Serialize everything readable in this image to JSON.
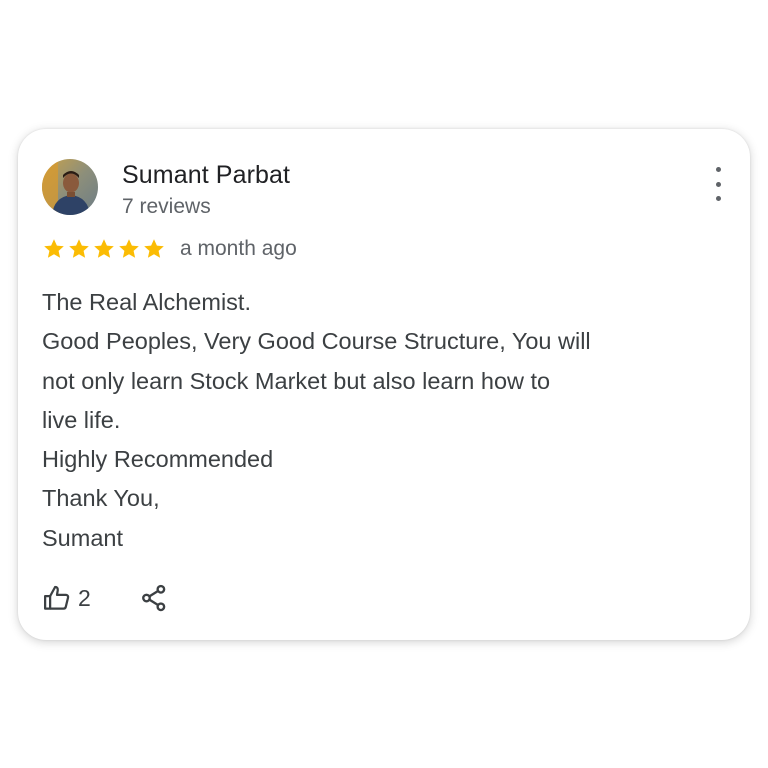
{
  "review": {
    "reviewer_name": "Sumant Parbat",
    "review_count": "7 reviews",
    "rating": 5,
    "rating_max": 5,
    "time_ago": "a month ago",
    "text_lines": [
      "The Real Alchemist.",
      "Good Peoples, Very Good Course Structure, You will",
      "not only learn Stock Market but also learn how to",
      "live life.",
      "Highly Recommended",
      "Thank You,",
      "Sumant"
    ],
    "like_count": "2"
  },
  "icons": {
    "menu": "more-vert-icon",
    "like": "thumbs-up-icon",
    "share": "share-icon",
    "star": "star-icon"
  },
  "colors": {
    "star": "#FBBC04",
    "name": "#202124",
    "secondary_text": "#5f6368",
    "body_text": "#3c4043"
  }
}
